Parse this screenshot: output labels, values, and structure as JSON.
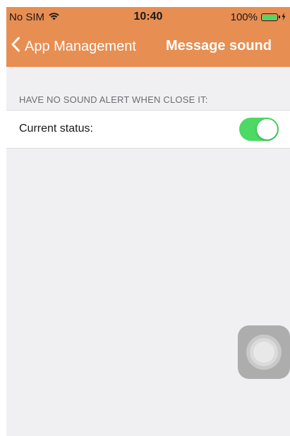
{
  "status_bar": {
    "carrier": "No SIM",
    "time": "10:40",
    "battery_percent": "100%",
    "battery_level": 1.0,
    "wifi_icon": "wifi-icon",
    "charging_icon": "charging-bolt-icon"
  },
  "nav": {
    "back_label": "App Management",
    "title": "Message sound",
    "back_icon": "chevron-left-icon"
  },
  "section": {
    "header": "HAVE NO SOUND ALERT WHEN CLOSE IT:"
  },
  "settings": {
    "current_status_label": "Current status:",
    "current_status_on": true
  },
  "colors": {
    "accent": "#e78e52",
    "toggle_on": "#4cd964",
    "background": "#f0f0f2"
  },
  "assistive_touch": {
    "icon": "assistive-touch-icon"
  }
}
